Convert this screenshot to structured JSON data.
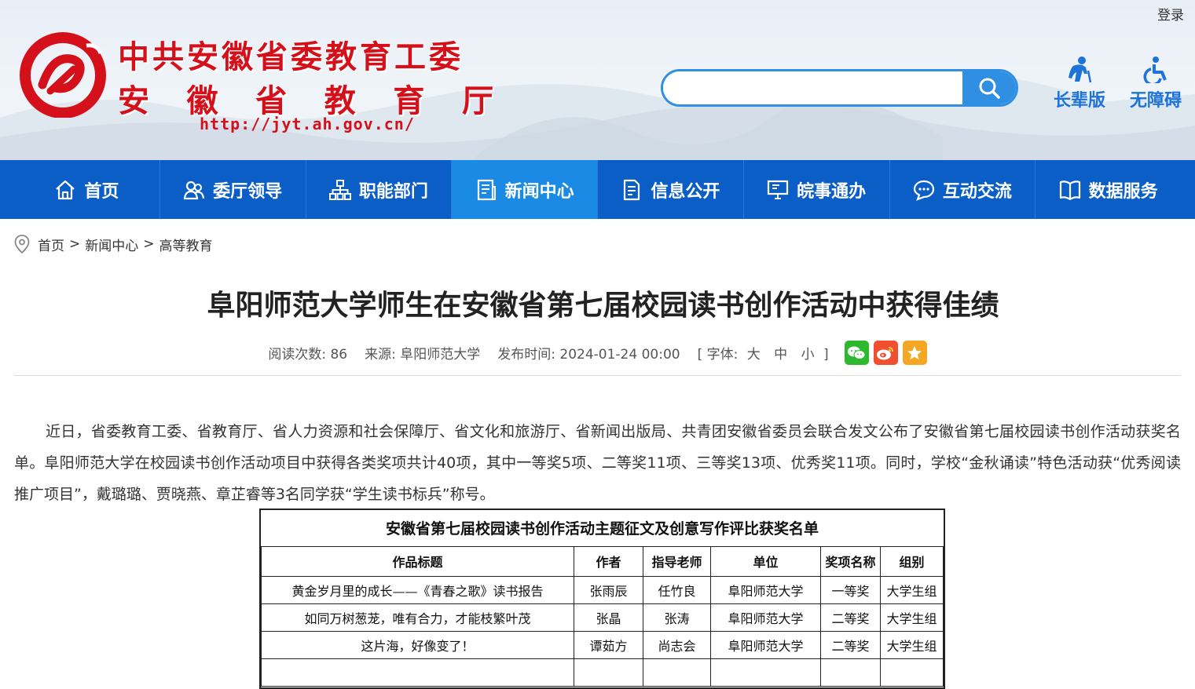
{
  "header": {
    "login": "登录",
    "title_line1": "中共安徽省委教育工委",
    "title_line2": [
      "安",
      "徽",
      "省",
      "教",
      "育",
      "厅"
    ],
    "url": "http://jyt.ah.gov.cn/",
    "search": {
      "placeholder": ""
    },
    "tools": [
      {
        "label": "长辈版",
        "icon": "elder-icon"
      },
      {
        "label": "无障碍",
        "icon": "accessibility-icon"
      }
    ]
  },
  "nav": [
    {
      "label": "首页",
      "icon": "home-icon"
    },
    {
      "label": "委厅领导",
      "icon": "people-icon"
    },
    {
      "label": "职能部门",
      "icon": "org-chart-icon"
    },
    {
      "label": "新闻中心",
      "icon": "news-icon",
      "active": true
    },
    {
      "label": "信息公开",
      "icon": "document-icon"
    },
    {
      "label": "皖事通办",
      "icon": "monitor-icon"
    },
    {
      "label": "互动交流",
      "icon": "chat-icon"
    },
    {
      "label": "数据服务",
      "icon": "book-icon"
    }
  ],
  "breadcrumb": [
    "首页",
    "新闻中心",
    "高等教育"
  ],
  "breadcrumb_sep": ">",
  "article": {
    "title": "阜阳师范大学师生在安徽省第七届校园读书创作活动中获得佳绩",
    "meta": {
      "views": "阅读次数: 86",
      "source": "来源: 阜阳师范大学",
      "published": "发布时间: 2024-01-24 00:00",
      "font_prefix": "[ 字体:",
      "font_sizes": [
        "大",
        "中",
        "小"
      ],
      "font_suffix": "]"
    },
    "body": "近日，省委教育工委、省教育厅、省人力资源和社会保障厅、省文化和旅游厅、省新闻出版局、共青团安徽省委员会联合发文公布了安徽省第七届校园读书创作活动获奖名单。阜阳师范大学在校园读书创作活动项目中获得各类奖项共计40项，其中一等奖5项、二等奖11项、三等奖13项、优秀奖11项。同时，学校“金秋诵读”特色活动获“优秀阅读推广项目”，戴璐璐、贾晓燕、章芷睿等3名同学获“学生读书标兵”称号。"
  },
  "award_table": {
    "caption": "安徽省第七届校园读书创作活动主题征文及创意写作评比获奖名单",
    "headers": [
      "作品标题",
      "作者",
      "指导老师",
      "单位",
      "奖项名称",
      "组别"
    ],
    "rows": [
      [
        "黄金岁月里的成长——《青春之歌》读书报告",
        "张雨辰",
        "任竹良",
        "阜阳师范大学",
        "一等奖",
        "大学生组"
      ],
      [
        "如同万树葱茏，唯有合力，才能枝繁叶茂",
        "张晶",
        "张涛",
        "阜阳师范大学",
        "二等奖",
        "大学生组"
      ],
      [
        "这片海，好像变了！",
        "谭茹方",
        "尚志会",
        "阜阳师范大学",
        "二等奖",
        "大学生组"
      ],
      [
        "",
        "",
        "",
        "",
        "",
        ""
      ]
    ]
  },
  "colors": {
    "brand_red": "#d4101a",
    "nav_blue": "#0c5ec7",
    "nav_active": "#1a8ae5",
    "accent_blue": "#2f8fe3"
  }
}
